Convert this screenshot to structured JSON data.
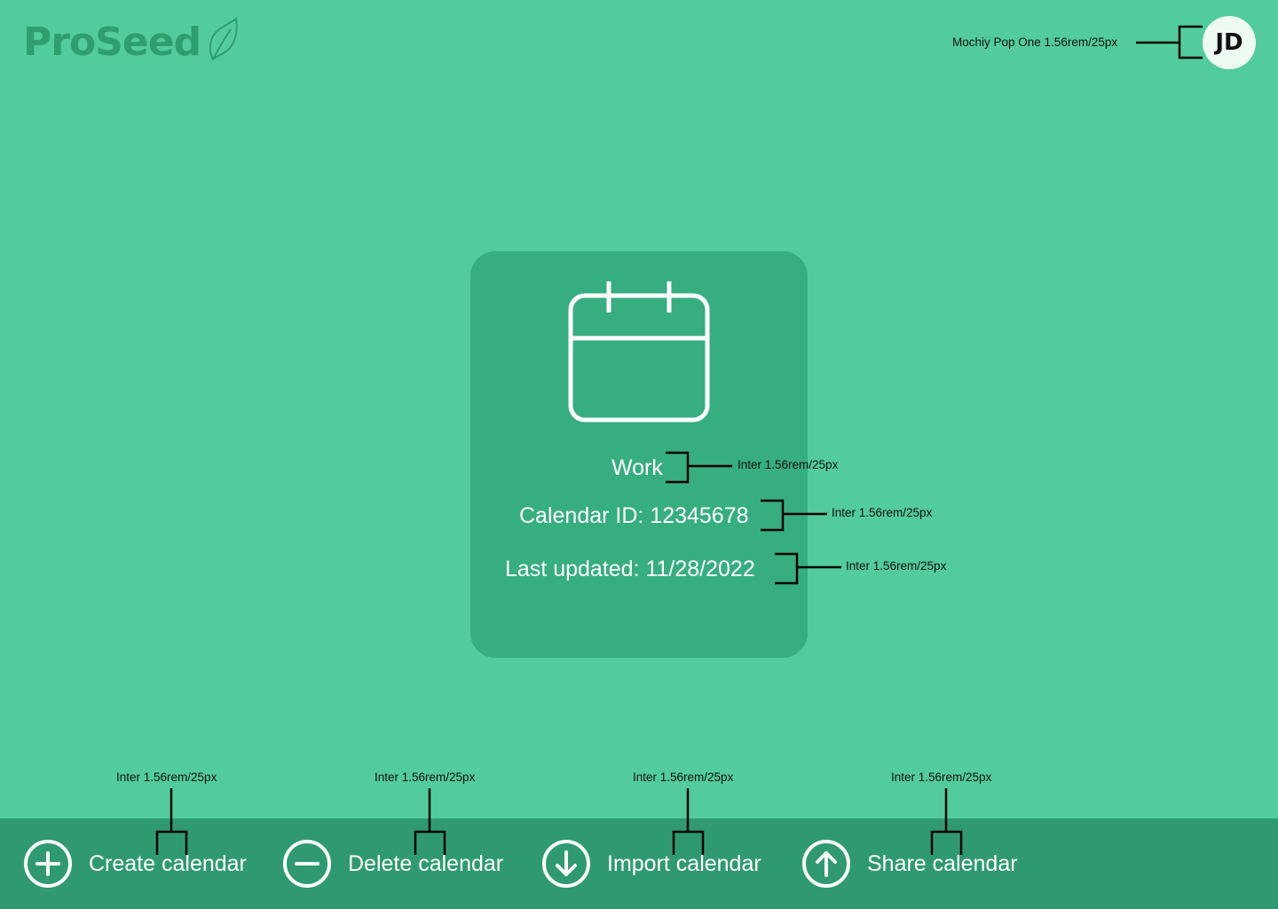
{
  "brand": {
    "name": "ProSeed",
    "logo_icon": "leaf-icon"
  },
  "user": {
    "initials": "JD",
    "annotation": "Mochiy Pop One 1.56rem/25px"
  },
  "calendar_card": {
    "icon": "calendar-icon",
    "name": "Work",
    "calendar_id": "Calendar ID: 12345678",
    "last_updated": "Last updated: 11/28/2022",
    "annotations": {
      "name": "Inter 1.56rem/25px",
      "calendar_id": "Inter 1.56rem/25px",
      "last_updated": "Inter 1.56rem/25px"
    }
  },
  "actions": [
    {
      "label": "Create calendar",
      "icon": "plus-circle-icon",
      "annotation": "Inter 1.56rem/25px"
    },
    {
      "label": "Delete calendar",
      "icon": "minus-circle-icon",
      "annotation": "Inter 1.56rem/25px"
    },
    {
      "label": "Import calendar",
      "icon": "arrow-down-circle-icon",
      "annotation": "Inter 1.56rem/25px"
    },
    {
      "label": "Share calendar",
      "icon": "arrow-up-circle-icon",
      "annotation": "Inter 1.56rem/25px"
    }
  ],
  "colors": {
    "background": "#52cc9c",
    "card": "#36ae80",
    "bottom_bar": "#2f9a72",
    "logo": "#2f9e6e"
  }
}
